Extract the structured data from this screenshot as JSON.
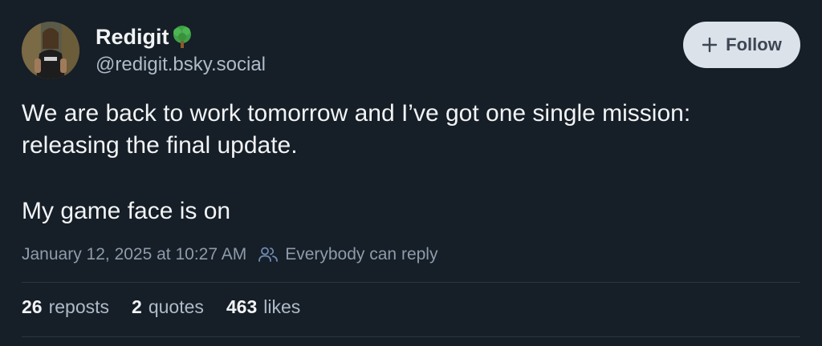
{
  "author": {
    "display_name": "Redigit",
    "handle": "@redigit.bsky.social",
    "emoji": "tree-icon"
  },
  "follow_button": {
    "label": "Follow",
    "icon": "plus-icon"
  },
  "post": {
    "paragraphs": [
      "We are back to work tomorrow and I’ve got one single mission: releasing the final update.",
      "My game face is on"
    ]
  },
  "meta": {
    "timestamp": "January 12, 2025 at 10:27 AM",
    "reply_setting": "Everybody can reply",
    "reply_icon": "people-icon"
  },
  "stats": {
    "reposts_count": "26",
    "reposts_label": "reposts",
    "quotes_count": "2",
    "quotes_label": "quotes",
    "likes_count": "463",
    "likes_label": "likes"
  },
  "colors": {
    "background": "#161e27",
    "text_primary": "#f1f3f5",
    "text_secondary": "#aebbc9",
    "text_muted": "#8d9bab",
    "follow_bg": "#dce2ea",
    "follow_text": "#3d4653",
    "divider": "#2b3643",
    "tree_green": "#3fa046",
    "tree_trunk": "#8a5a2b"
  }
}
